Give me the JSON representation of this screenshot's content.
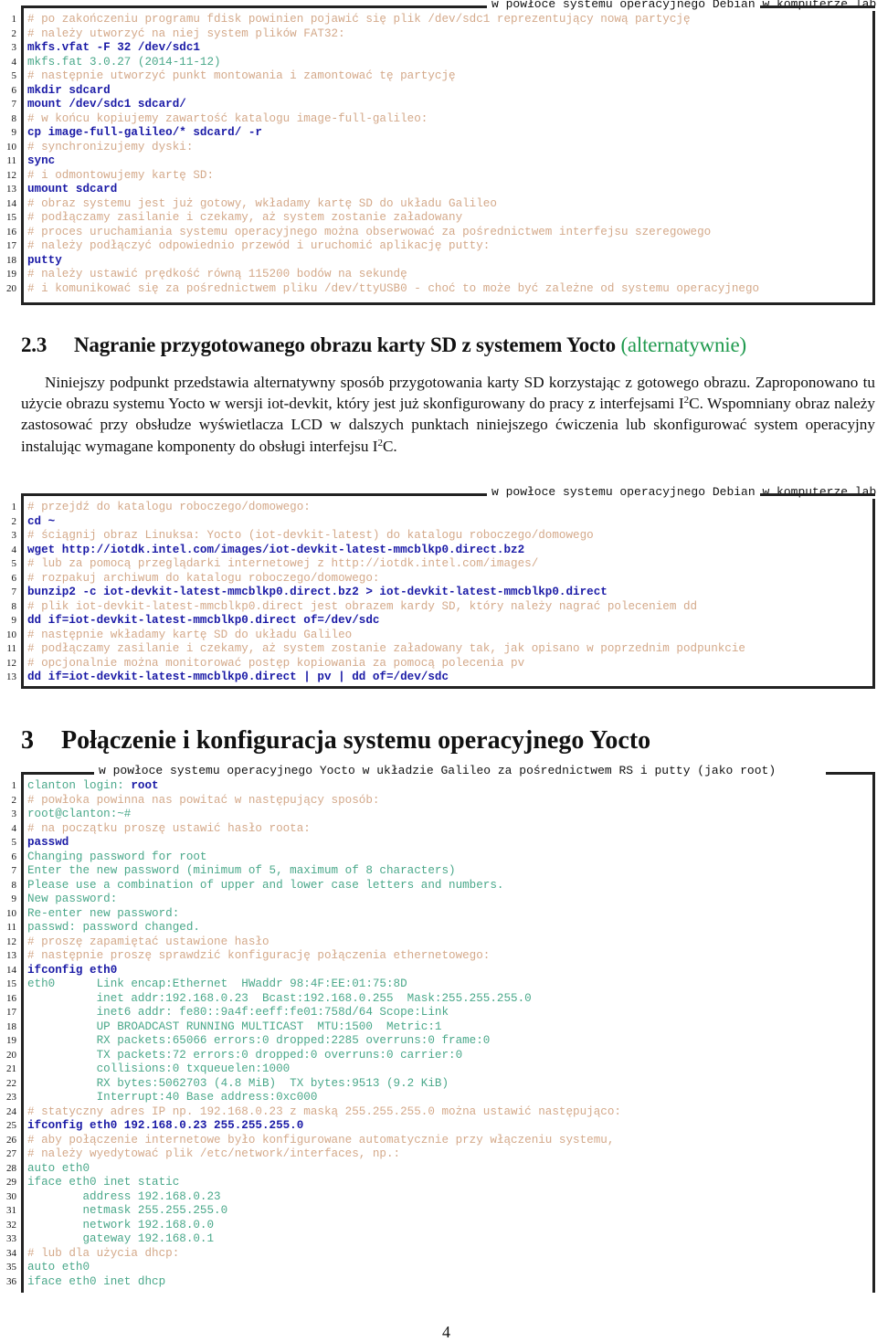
{
  "listing1": {
    "title": "w powłoce systemu operacyjnego Debian w komputerze laboratoryjnym (jako root)",
    "lines": [
      {
        "n": "1",
        "type": "comment",
        "text": "# po zakończeniu programu fdisk powinien pojawić się plik /dev/sdc1 reprezentujący nową partycję"
      },
      {
        "n": "2",
        "type": "comment",
        "text": "# należy utworzyć na niej system plików FAT32:"
      },
      {
        "n": "3",
        "type": "cmd",
        "text": "mkfs.vfat -F 32 /dev/sdc1"
      },
      {
        "n": "4",
        "type": "out",
        "text": "mkfs.fat 3.0.27 (2014-11-12)"
      },
      {
        "n": "5",
        "type": "comment",
        "text": "# następnie utworzyć punkt montowania i zamontować tę partycję"
      },
      {
        "n": "6",
        "type": "cmd",
        "text": "mkdir sdcard"
      },
      {
        "n": "7",
        "type": "cmd",
        "text": "mount /dev/sdc1 sdcard/"
      },
      {
        "n": "8",
        "type": "comment",
        "text": "# w końcu kopiujemy zawartość katalogu image-full-galileo:"
      },
      {
        "n": "9",
        "type": "cmd",
        "text": "cp image-full-galileo/* sdcard/ -r"
      },
      {
        "n": "10",
        "type": "comment",
        "text": "# synchronizujemy dyski:"
      },
      {
        "n": "11",
        "type": "cmd",
        "text": "sync"
      },
      {
        "n": "12",
        "type": "comment",
        "text": "# i odmontowujemy kartę SD:"
      },
      {
        "n": "13",
        "type": "cmd",
        "text": "umount sdcard"
      },
      {
        "n": "14",
        "type": "comment",
        "text": "# obraz systemu jest już gotowy, wkładamy kartę SD do układu Galileo"
      },
      {
        "n": "15",
        "type": "comment",
        "text": "# podłączamy zasilanie i czekamy, aż system zostanie załadowany"
      },
      {
        "n": "16",
        "type": "comment",
        "text": "# proces uruchamiania systemu operacyjnego można obserwować za pośrednictwem interfejsu szeregowego"
      },
      {
        "n": "17",
        "type": "comment",
        "text": "# należy podłączyć odpowiednio przewód i uruchomić aplikację putty:"
      },
      {
        "n": "18",
        "type": "cmd",
        "text": "putty"
      },
      {
        "n": "19",
        "type": "comment",
        "text": "# należy ustawić prędkość równą 115200 bodów na sekundę"
      },
      {
        "n": "20",
        "type": "comment",
        "text": "# i komunikować się za pośrednictwem pliku /dev/ttyUSB0 - choć to może być zależne od systemu operacyjnego"
      }
    ]
  },
  "section_2_3": {
    "number": "2.3",
    "title": "Nagranie przygotowanego obrazu karty SD z systemem Yocto",
    "title_note": "(alternatywnie)",
    "paragraph": {
      "part1": "Niniejszy podpunkt przedstawia alternatywny sposób przygotowania karty SD korzystając z gotowego obrazu. Zaproponowano tu użycie obrazu systemu Yocto w wersji iot-devkit, który jest już skonfigurowany do pracy z interfejsami I",
      "sup1": "2",
      "part2": "C. Wspomniany obraz należy zastosować przy obsłudze wyświetlacza LCD w dalszych punktach niniejszego ćwiczenia lub skonfigurować system operacyjny instalując wymagane komponenty do obsługi interfejsu I",
      "sup2": "2",
      "part3": "C."
    }
  },
  "listing2": {
    "title": "w powłoce systemu operacyjnego Debian w komputerze laboratoryjnym (jako root)",
    "lines": [
      {
        "n": "1",
        "type": "comment",
        "text": "# przejdź do katalogu roboczego/domowego:"
      },
      {
        "n": "2",
        "type": "cmd",
        "text": "cd ~"
      },
      {
        "n": "3",
        "type": "comment",
        "text": "# ściągnij obraz Linuksa: Yocto (iot-devkit-latest) do katalogu roboczego/domowego"
      },
      {
        "n": "4",
        "type": "cmd",
        "text": "wget http://iotdk.intel.com/images/iot-devkit-latest-mmcblkp0.direct.bz2"
      },
      {
        "n": "5",
        "type": "comment",
        "text": "# lub za pomocą przeglądarki internetowej z http://iotdk.intel.com/images/"
      },
      {
        "n": "6",
        "type": "comment",
        "text": "# rozpakuj archiwum do katalogu roboczego/domowego:"
      },
      {
        "n": "7",
        "type": "cmd",
        "text": "bunzip2 -c iot-devkit-latest-mmcblkp0.direct.bz2 > iot-devkit-latest-mmcblkp0.direct"
      },
      {
        "n": "8",
        "type": "comment",
        "text": "# plik iot-devkit-latest-mmcblkp0.direct jest obrazem kardy SD, który należy nagrać poleceniem dd"
      },
      {
        "n": "9",
        "type": "cmd",
        "text": "dd if=iot-devkit-latest-mmcblkp0.direct of=/dev/sdc"
      },
      {
        "n": "10",
        "type": "comment",
        "text": "# następnie wkładamy kartę SD do układu Galileo"
      },
      {
        "n": "11",
        "type": "comment",
        "text": "# podłączamy zasilanie i czekamy, aż system zostanie załadowany tak, jak opisano w poprzednim podpunkcie"
      },
      {
        "n": "12",
        "type": "comment",
        "text": "# opcjonalnie można monitorować postęp kopiowania za pomocą polecenia pv"
      },
      {
        "n": "13",
        "type": "cmd",
        "text": "dd if=iot-devkit-latest-mmcblkp0.direct | pv | dd of=/dev/sdc"
      }
    ]
  },
  "section_3": {
    "number": "3",
    "title": "Połączenie i konfiguracja systemu operacyjnego Yocto"
  },
  "listing3": {
    "title": "w powłoce systemu operacyjnego Yocto w układzie Galileo za pośrednictwem RS i putty (jako root)",
    "lines": [
      {
        "n": "1",
        "type": "mixed",
        "parts": [
          {
            "type": "out",
            "text": "clanton login: "
          },
          {
            "type": "cmd",
            "text": "root"
          }
        ]
      },
      {
        "n": "2",
        "type": "comment",
        "text": "# powłoka powinna nas powitać w następujący sposób:"
      },
      {
        "n": "3",
        "type": "out",
        "text": "root@clanton:~#"
      },
      {
        "n": "4",
        "type": "comment",
        "text": "# na początku proszę ustawić hasło roota:"
      },
      {
        "n": "5",
        "type": "cmd",
        "text": "passwd"
      },
      {
        "n": "6",
        "type": "out",
        "text": "Changing password for root"
      },
      {
        "n": "7",
        "type": "out",
        "text": "Enter the new password (minimum of 5, maximum of 8 characters)"
      },
      {
        "n": "8",
        "type": "out",
        "text": "Please use a combination of upper and lower case letters and numbers."
      },
      {
        "n": "9",
        "type": "out",
        "text": "New password:"
      },
      {
        "n": "10",
        "type": "out",
        "text": "Re-enter new password:"
      },
      {
        "n": "11",
        "type": "out",
        "text": "passwd: password changed."
      },
      {
        "n": "12",
        "type": "comment",
        "text": "# proszę zapamiętać ustawione hasło"
      },
      {
        "n": "13",
        "type": "comment",
        "text": "# następnie proszę sprawdzić konfigurację połączenia ethernetowego:"
      },
      {
        "n": "14",
        "type": "cmd",
        "text": "ifconfig eth0"
      },
      {
        "n": "15",
        "type": "out",
        "text": "eth0      Link encap:Ethernet  HWaddr 98:4F:EE:01:75:8D"
      },
      {
        "n": "16",
        "type": "out",
        "text": "          inet addr:192.168.0.23  Bcast:192.168.0.255  Mask:255.255.255.0"
      },
      {
        "n": "17",
        "type": "out",
        "text": "          inet6 addr: fe80::9a4f:eeff:fe01:758d/64 Scope:Link"
      },
      {
        "n": "18",
        "type": "out",
        "text": "          UP BROADCAST RUNNING MULTICAST  MTU:1500  Metric:1"
      },
      {
        "n": "19",
        "type": "out",
        "text": "          RX packets:65066 errors:0 dropped:2285 overruns:0 frame:0"
      },
      {
        "n": "20",
        "type": "out",
        "text": "          TX packets:72 errors:0 dropped:0 overruns:0 carrier:0"
      },
      {
        "n": "21",
        "type": "out",
        "text": "          collisions:0 txqueuelen:1000"
      },
      {
        "n": "22",
        "type": "out",
        "text": "          RX bytes:5062703 (4.8 MiB)  TX bytes:9513 (9.2 KiB)"
      },
      {
        "n": "23",
        "type": "out",
        "text": "          Interrupt:40 Base address:0xc000"
      },
      {
        "n": "24",
        "type": "comment",
        "text": "# statyczny adres IP np. 192.168.0.23 z maską 255.255.255.0 można ustawić następująco:"
      },
      {
        "n": "25",
        "type": "cmd",
        "text": "ifconfig eth0 192.168.0.23 255.255.255.0"
      },
      {
        "n": "26",
        "type": "comment",
        "text": "# aby połączenie internetowe było konfigurowane automatycznie przy włączeniu systemu,"
      },
      {
        "n": "27",
        "type": "comment",
        "text": "# należy wyedytować plik /etc/network/interfaces, np.:"
      },
      {
        "n": "28",
        "type": "out",
        "text": "auto eth0"
      },
      {
        "n": "29",
        "type": "out",
        "text": "iface eth0 inet static"
      },
      {
        "n": "30",
        "type": "out",
        "text": "        address 192.168.0.23"
      },
      {
        "n": "31",
        "type": "out",
        "text": "        netmask 255.255.255.0"
      },
      {
        "n": "32",
        "type": "out",
        "text": "        network 192.168.0.0"
      },
      {
        "n": "33",
        "type": "out",
        "text": "        gateway 192.168.0.1"
      },
      {
        "n": "34",
        "type": "comment",
        "text": "# lub dla użycia dhcp:"
      },
      {
        "n": "35",
        "type": "out",
        "text": "auto eth0"
      },
      {
        "n": "36",
        "type": "out",
        "text": "iface eth0 inet dhcp"
      }
    ]
  },
  "page_number": "4"
}
